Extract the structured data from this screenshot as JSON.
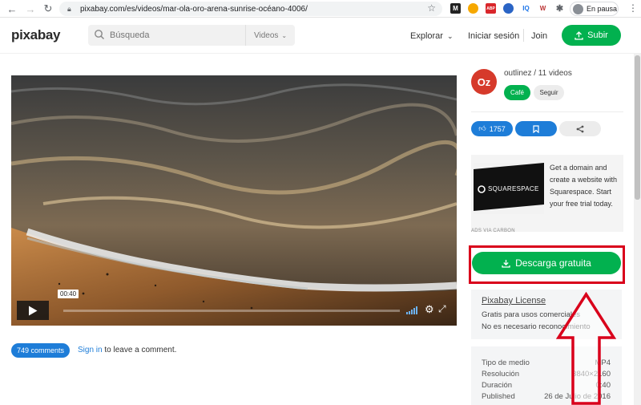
{
  "browser": {
    "url": "pixabay.com/es/videos/mar-ola-oro-arena-sunrise-océano-4006/",
    "profile_label": "En pausa",
    "extensions": [
      "M",
      "",
      "ABP",
      "",
      "IQ",
      "W",
      ""
    ]
  },
  "header": {
    "logo": "pixabay",
    "search_placeholder": "Búsqueda",
    "search_type": "Videos",
    "explore": "Explorar",
    "login": "Iniciar sesión",
    "join": "Join",
    "upload": "Subir"
  },
  "player": {
    "current_time": "00:40"
  },
  "comments": {
    "count_label": "749 comments",
    "signin_link": "Sign in",
    "signin_rest": " to leave a comment."
  },
  "author": {
    "avatar_text": "Oz",
    "name_line": "outlinez / 11 videos",
    "cafe_label": "Café",
    "follow_label": "Seguir"
  },
  "actions": {
    "likes": "1757"
  },
  "ad": {
    "brand": "SQUARESPACE",
    "text": "Get a domain and create a website with Squarespace. Start your free trial today.",
    "via": "ADS VIA CARBON"
  },
  "download": {
    "label": "Descarga gratuita"
  },
  "license": {
    "title": "Pixabay License",
    "line1": "Gratis para usos comerciales",
    "line2": "No es necesario reconocimiento"
  },
  "info": [
    {
      "key": "Tipo de medio",
      "value": "MP4"
    },
    {
      "key": "Resolución",
      "value": "3840×2160"
    },
    {
      "key": "Duración",
      "value": "0:40"
    },
    {
      "key": "Published",
      "value": "26 de Julio de 2016"
    }
  ],
  "colors": {
    "accent_green": "#02b14f",
    "link_blue": "#1e7dd8",
    "highlight_red": "#d9001b"
  }
}
